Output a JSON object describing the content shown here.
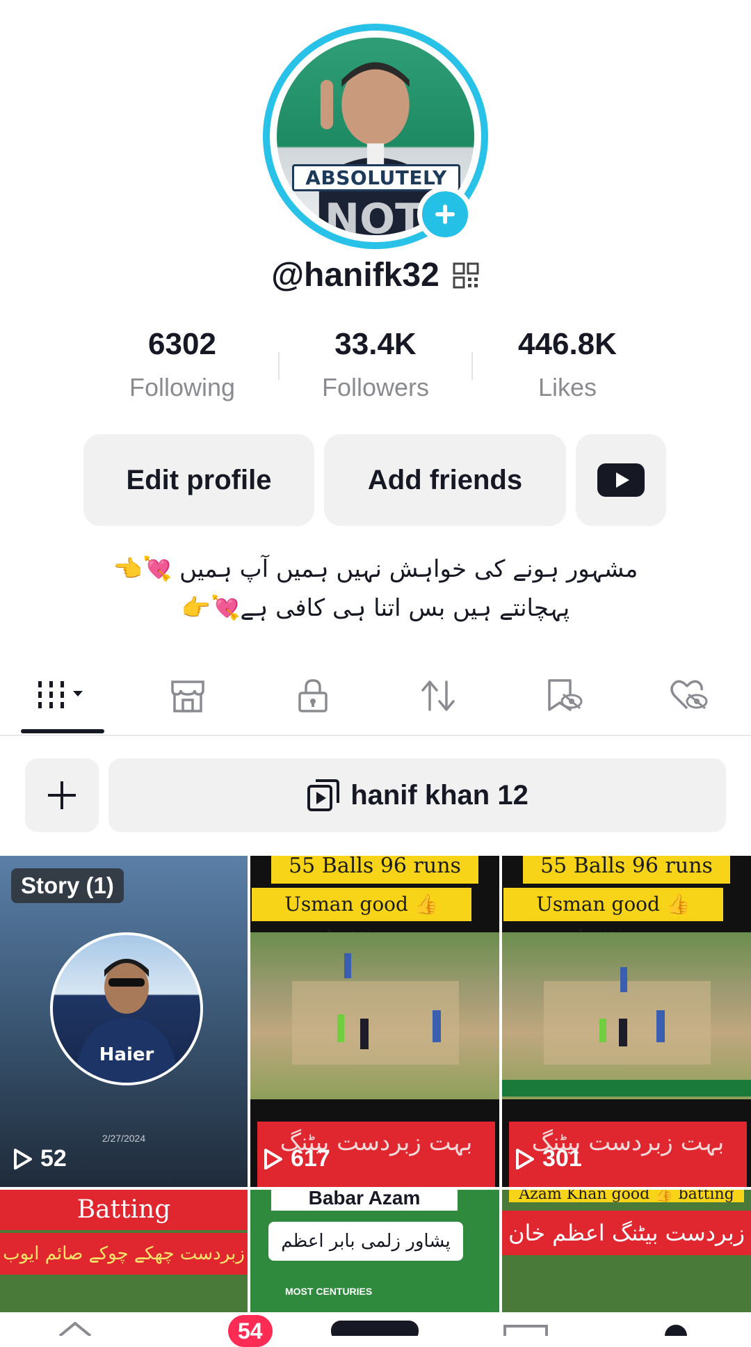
{
  "profile": {
    "username": "@hanifk32",
    "avatar_caption_top": "ABSOLUTELY",
    "avatar_caption_bottom": "NOT"
  },
  "stats": [
    {
      "value": "6302",
      "label": "Following"
    },
    {
      "value": "33.4K",
      "label": "Followers"
    },
    {
      "value": "446.8K",
      "label": "Likes"
    }
  ],
  "actions": {
    "edit_profile": "Edit profile",
    "add_friends": "Add friends",
    "youtube_icon": "youtube-icon"
  },
  "bio": {
    "line1": "مشہور ہونے کی خواہش نہیں ہمیں آپ ہمیں 💘👈",
    "line2": "پہچانتے ہیں بس اتنا ہی کافی ہے💘👉"
  },
  "tabs": [
    "videos-grid-icon",
    "shop-icon",
    "lock-icon",
    "repost-icon",
    "saved-icon",
    "liked-icon"
  ],
  "playlist": {
    "name": "hanif khan 12"
  },
  "grid": {
    "story": {
      "badge": "Story (1)",
      "date": "2/27/2024",
      "views": "52"
    },
    "videos": [
      {
        "top_banner": "55 Balls 96 runs",
        "sub_banner": "Usman good 👍 batting",
        "red_text": "بہت زبردست بیٹنگ",
        "views": "617"
      },
      {
        "top_banner": "55 Balls 96 runs",
        "sub_banner": "Usman good 👍 batting",
        "red_text": "بہت زبردست بیٹنگ",
        "views": "301"
      }
    ],
    "row2": [
      {
        "title": "Batting",
        "subtitle": "زبردست چھکے چوکے صائم ایوب"
      },
      {
        "title": "Babar Azam",
        "subtitle": "پشاور زلمی بابر اعظم",
        "label": "MOST CENTURIES"
      },
      {
        "title": "Azam Khan good 👍 batting",
        "subtitle": "زبردست بیٹنگ اعظم خان"
      }
    ]
  },
  "nav": {
    "inbox_badge": "54"
  }
}
